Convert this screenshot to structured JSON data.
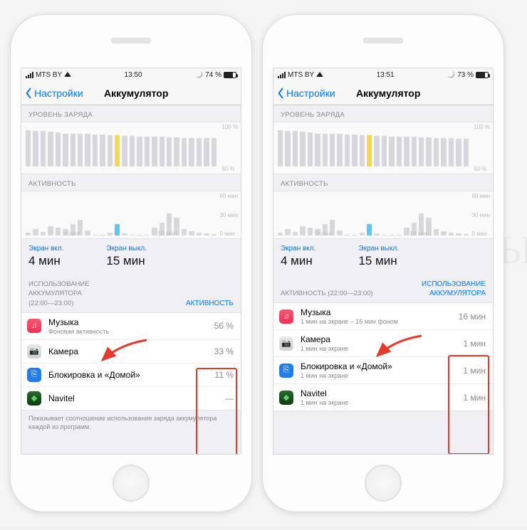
{
  "phones": {
    "left": {
      "status": {
        "carrier": "MTS BY",
        "time": "13:50",
        "battery_pct": "74 %",
        "battery_fill": 74
      },
      "nav": {
        "back": "Настройки",
        "title": "Аккумулятор"
      },
      "charge_header": "УРОВЕНЬ ЗАРЯДА",
      "activity_header": "АКТИВНОСТЬ",
      "y_charge": [
        "100 %",
        "50 %"
      ],
      "y_activity": [
        "60 мин",
        "30 мин",
        "0 мин"
      ],
      "x_dates": [
        "9 сент.",
        "10 сент."
      ],
      "screen_on": {
        "label": "Экран вкл.",
        "value": "4 мин"
      },
      "screen_off": {
        "label": "Экран выкл.",
        "value": "15 мин"
      },
      "usage": {
        "sub1": "ИСПОЛЬЗОВАНИЕ",
        "sub2": "АККУМУЛЯТОРА",
        "sub3": "(22:00—23:00)",
        "link": "АКТИВНОСТЬ"
      },
      "rows": [
        {
          "icon": "music",
          "title": "Музыка",
          "sub": "Фоновая активность",
          "val": "56 %"
        },
        {
          "icon": "camera",
          "title": "Камера",
          "sub": "",
          "val": "33 %"
        },
        {
          "icon": "lock",
          "title": "Блокировка и «Домой»",
          "sub": "",
          "val": "11 %"
        },
        {
          "icon": "navitel",
          "title": "Navitel",
          "sub": "",
          "val": "—"
        }
      ],
      "footer": "Показывает соотношение использования заряда аккумулятора каждой из программ."
    },
    "right": {
      "status": {
        "carrier": "MTS BY",
        "time": "13:51",
        "battery_pct": "73 %",
        "battery_fill": 73
      },
      "nav": {
        "back": "Настройки",
        "title": "Аккумулятор"
      },
      "charge_header": "УРОВЕНЬ ЗАРЯДА",
      "activity_header": "АКТИВНОСТЬ",
      "y_charge": [
        "100 %",
        "50 %"
      ],
      "y_activity": [
        "60 мин",
        "30 мин",
        "0 мин"
      ],
      "x_dates": [
        "9 сент.",
        "10 сент."
      ],
      "screen_on": {
        "label": "Экран вкл.",
        "value": "4 мин"
      },
      "screen_off": {
        "label": "Экран выкл.",
        "value": "15 мин"
      },
      "usage": {
        "sub1": "АКТИВНОСТЬ (22:00—23:00)",
        "link1": "ИСПОЛЬЗОВАНИЕ",
        "link2": "АККУМУЛЯТОРА"
      },
      "rows": [
        {
          "icon": "music",
          "title": "Музыка",
          "sub": "1 мин на экране – 15 мин фоном",
          "val": "16 мин"
        },
        {
          "icon": "camera",
          "title": "Камера",
          "sub": "1 мин на экране",
          "val": "1 мин"
        },
        {
          "icon": "lock",
          "title": "Блокировка и «Домой»",
          "sub": "1 мин на экране",
          "val": "1 мин"
        },
        {
          "icon": "navitel",
          "title": "Navitel",
          "sub": "1 мин на экране",
          "val": "1 мин"
        }
      ]
    }
  },
  "chart_data": {
    "type": "bar",
    "note": "Two stacked mini-charts per phone: battery level (%) timeline and activity (minutes) timeline. Heights are visual estimates; yellow = highlighted hour.",
    "left_phone": {
      "charge_bars_pct": [
        95,
        92,
        92,
        90,
        88,
        86,
        86,
        85,
        85,
        84,
        84,
        82,
        82,
        80,
        80,
        78,
        78,
        77,
        77,
        76,
        76,
        75,
        75,
        74,
        74,
        74
      ],
      "charge_highlight_index": 12,
      "activity_bars_min": [
        4,
        10,
        6,
        14,
        12,
        10,
        18,
        24,
        8,
        0,
        0,
        4,
        18,
        3,
        0,
        0,
        0,
        12,
        20,
        34,
        28,
        10,
        7,
        5,
        3,
        2
      ],
      "activity_highlight_index": 12
    },
    "right_phone": {
      "charge_bars_pct": [
        95,
        92,
        92,
        90,
        88,
        86,
        86,
        85,
        85,
        84,
        84,
        82,
        82,
        80,
        80,
        78,
        78,
        77,
        77,
        76,
        76,
        75,
        75,
        74,
        73,
        73
      ],
      "charge_highlight_index": 12,
      "activity_bars_min": [
        4,
        10,
        6,
        14,
        12,
        10,
        18,
        24,
        8,
        0,
        0,
        4,
        18,
        3,
        0,
        0,
        0,
        12,
        20,
        34,
        28,
        10,
        7,
        5,
        3,
        2
      ],
      "activity_highlight_index": 12
    }
  },
  "watermark": "ЯБЛЫК"
}
